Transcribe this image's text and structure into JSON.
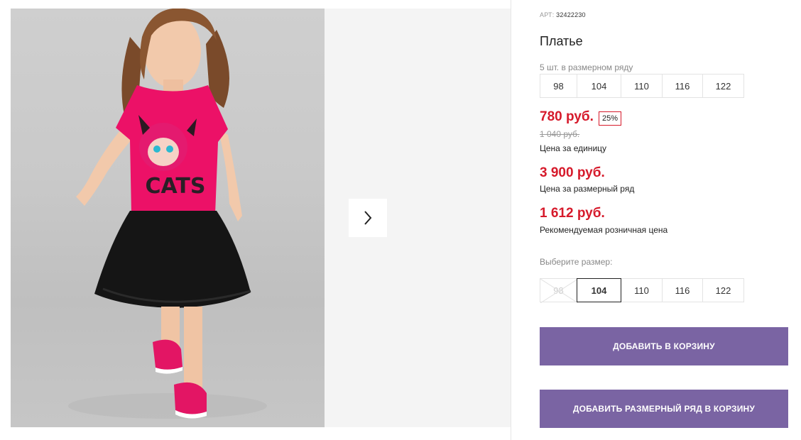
{
  "product": {
    "sku_label": "АРТ:",
    "sku_value": "32422230",
    "title": "Платье",
    "pack_label": "5 шт. в размерном ряду",
    "pack_sizes": [
      "98",
      "104",
      "110",
      "116",
      "122"
    ]
  },
  "pricing": {
    "unit_price": "780 руб.",
    "discount_badge": "25%",
    "old_price": "1 040 руб.",
    "unit_caption": "Цена за единицу",
    "pack_price": "3 900 руб.",
    "pack_caption": "Цена за размерный ряд",
    "retail_price": "1 612 руб.",
    "retail_caption": "Рекомендуемая розничная цена",
    "accent_color": "#d61a2b"
  },
  "size_picker": {
    "label": "Выберите размер:",
    "sizes": [
      "98",
      "104",
      "110",
      "116",
      "122"
    ],
    "selected": "104",
    "unavailable": [
      "98"
    ]
  },
  "actions": {
    "add_to_cart": "ДОБАВИТЬ В КОРЗИНУ",
    "add_pack_to_cart": "ДОБАВИТЬ РАЗМЕРНЫЙ РЯД В КОРЗИНУ",
    "button_color": "#7a64a3"
  },
  "gallery": {
    "photo_print_text": "CATS",
    "next_icon": "chevron-right-icon"
  }
}
